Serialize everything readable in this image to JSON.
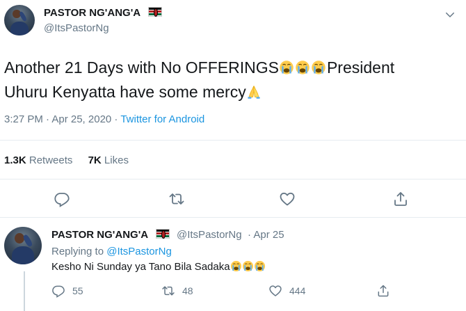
{
  "main_tweet": {
    "display_name": "PASTOR NG'ANG'A",
    "handle": "@ItsPastorNg",
    "text_line1": "Another 21 Days with No OFFERINGS",
    "text_line1_tail": "President",
    "text_line2": "Uhuru Kenyatta have some mercy",
    "emojis_line1": [
      "loudly-crying-face",
      "loudly-crying-face",
      "loudly-crying-face"
    ],
    "emoji_line2": "folded-hands",
    "timestamp": "3:27 PM · Apr 25, 2020 · ",
    "source": "Twitter for Android",
    "retweets_count": "1.3K",
    "retweets_label": "Retweets",
    "likes_count": "7K",
    "likes_label": "Likes",
    "actions": [
      "reply-icon",
      "retweet-icon",
      "like-icon",
      "share-icon"
    ]
  },
  "reply_tweet": {
    "display_name": "PASTOR NG'ANG'A",
    "handle": "@ItsPastorNg",
    "date": "· Apr 25",
    "replying_prefix": "Replying to ",
    "replying_to": "@ItsPastorNg",
    "text": "Kesho Ni Sunday ya Tano Bila Sadaka",
    "emojis": [
      "loudly-crying-face",
      "loudly-crying-face",
      "loudly-crying-face"
    ],
    "reply_count": "55",
    "retweet_count": "48",
    "like_count": "444"
  },
  "colors": {
    "text": "#14171a",
    "secondary": "#657786",
    "link": "#1b95e0",
    "divider": "#e6ecf0"
  }
}
